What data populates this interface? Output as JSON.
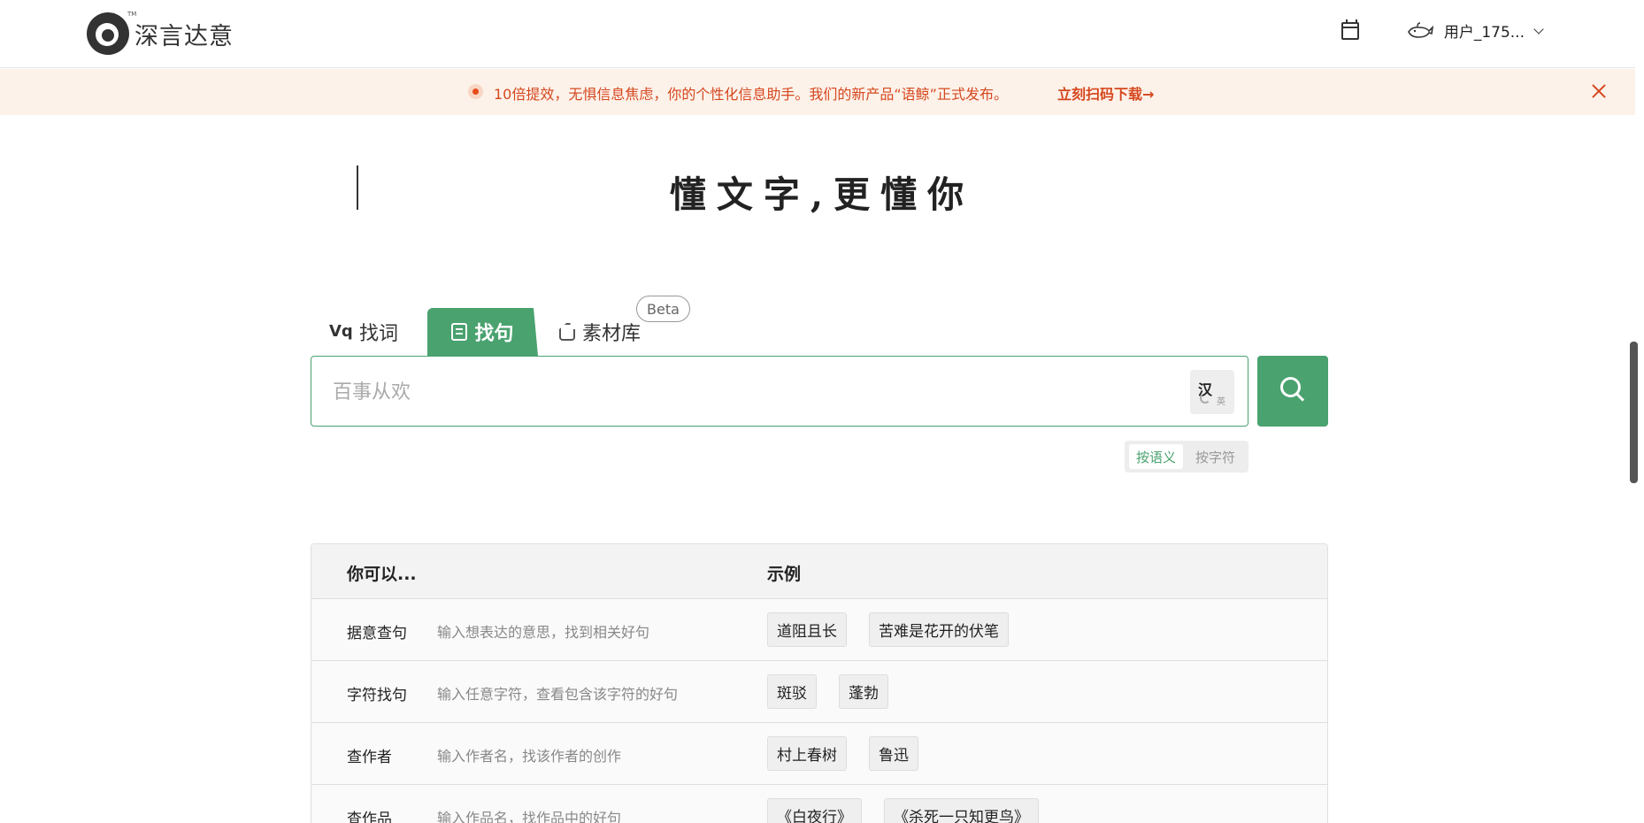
{
  "header": {
    "logo_text": "深言达意",
    "logo_tm": "TM",
    "user_name": "用户_175..."
  },
  "banner": {
    "text": "10倍提效，无惧信息焦虑，你的个性化信息助手。我们的新产品“语鲸”正式发布。",
    "link": "立刻扫码下载→"
  },
  "hero": {
    "slogan": "懂文字,更懂你"
  },
  "tabs": [
    {
      "label": "找词",
      "icon": "Vq"
    },
    {
      "label": "找句"
    },
    {
      "label": "素材库",
      "badge": "Beta"
    }
  ],
  "search": {
    "placeholder": "百事从欢",
    "lang_primary": "汉",
    "lang_secondary": "英"
  },
  "modes": {
    "semantic": "按语义",
    "character": "按字符"
  },
  "table": {
    "headers": [
      "你可以...",
      "示例"
    ],
    "rows": [
      {
        "name": "据意查句",
        "desc": "输入想表达的意思，找到相关好句",
        "examples": [
          "道阻且长",
          "苦难是花开的伏笔"
        ]
      },
      {
        "name": "字符找句",
        "desc": "输入任意字符，查看包含该字符的好句",
        "examples": [
          "斑驳",
          "蓬勃"
        ]
      },
      {
        "name": "查作者",
        "desc": "输入作者名，找该作者的创作",
        "examples": [
          "村上春树",
          "鲁迅"
        ]
      },
      {
        "name": "查作品",
        "desc": "输入作品名，找作品中的好句",
        "examples": [
          "《白夜行》",
          "《杀死一只知更鸟》"
        ]
      }
    ]
  },
  "colors": {
    "accent": "#4aa26f",
    "banner_bg": "#fdf2ea",
    "banner_text": "#d5471e"
  }
}
